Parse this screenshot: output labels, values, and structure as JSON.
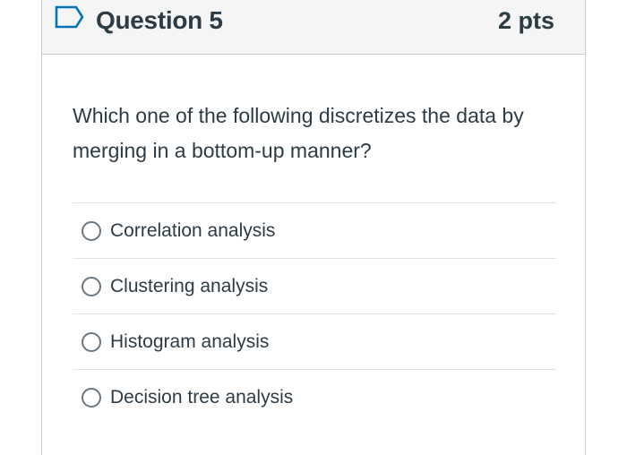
{
  "question": {
    "title": "Question 5",
    "points": "2 pts",
    "text": "Which one of the following discretizes the data by merging in a bottom-up manner?",
    "flag_icon": "flag-icon"
  },
  "answers": [
    {
      "label": "Correlation analysis",
      "selected": false
    },
    {
      "label": "Clustering analysis",
      "selected": false
    },
    {
      "label": "Histogram analysis",
      "selected": false
    },
    {
      "label": "Decision tree analysis",
      "selected": false
    }
  ],
  "colors": {
    "header_bg": "#f5f5f5",
    "text": "#2d3b45",
    "flag_blue": "#0374b5",
    "border": "#c7cdd1"
  }
}
